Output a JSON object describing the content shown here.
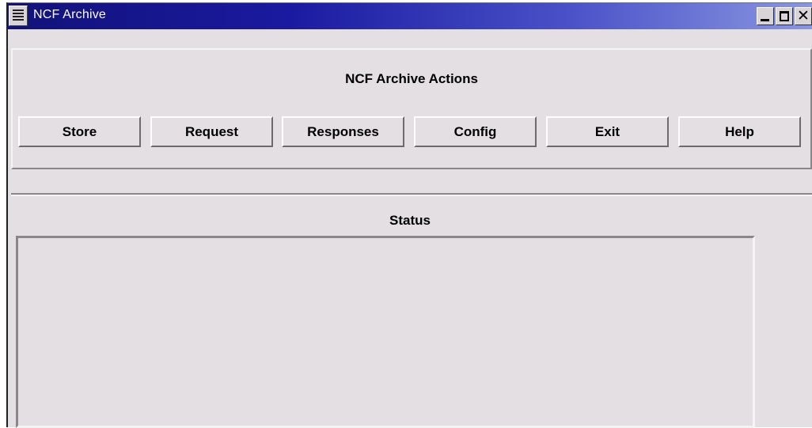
{
  "window": {
    "title": "NCF Archive",
    "controls": {
      "minimize": "",
      "maximize": "",
      "close": "✕"
    }
  },
  "actions": {
    "title": "NCF Archive Actions",
    "buttons": {
      "store": "Store",
      "request": "Request",
      "responses": "Responses",
      "config": "Config",
      "exit": "Exit",
      "help": "Help"
    }
  },
  "status": {
    "title": "Status",
    "text": ""
  },
  "colors": {
    "titlebar_start": "#12127a",
    "titlebar_end": "#8a96e0",
    "window_bg": "#e3dfe2"
  },
  "icons": [
    "window-menu-icon",
    "minimize-icon",
    "maximize-icon",
    "close-icon"
  ]
}
